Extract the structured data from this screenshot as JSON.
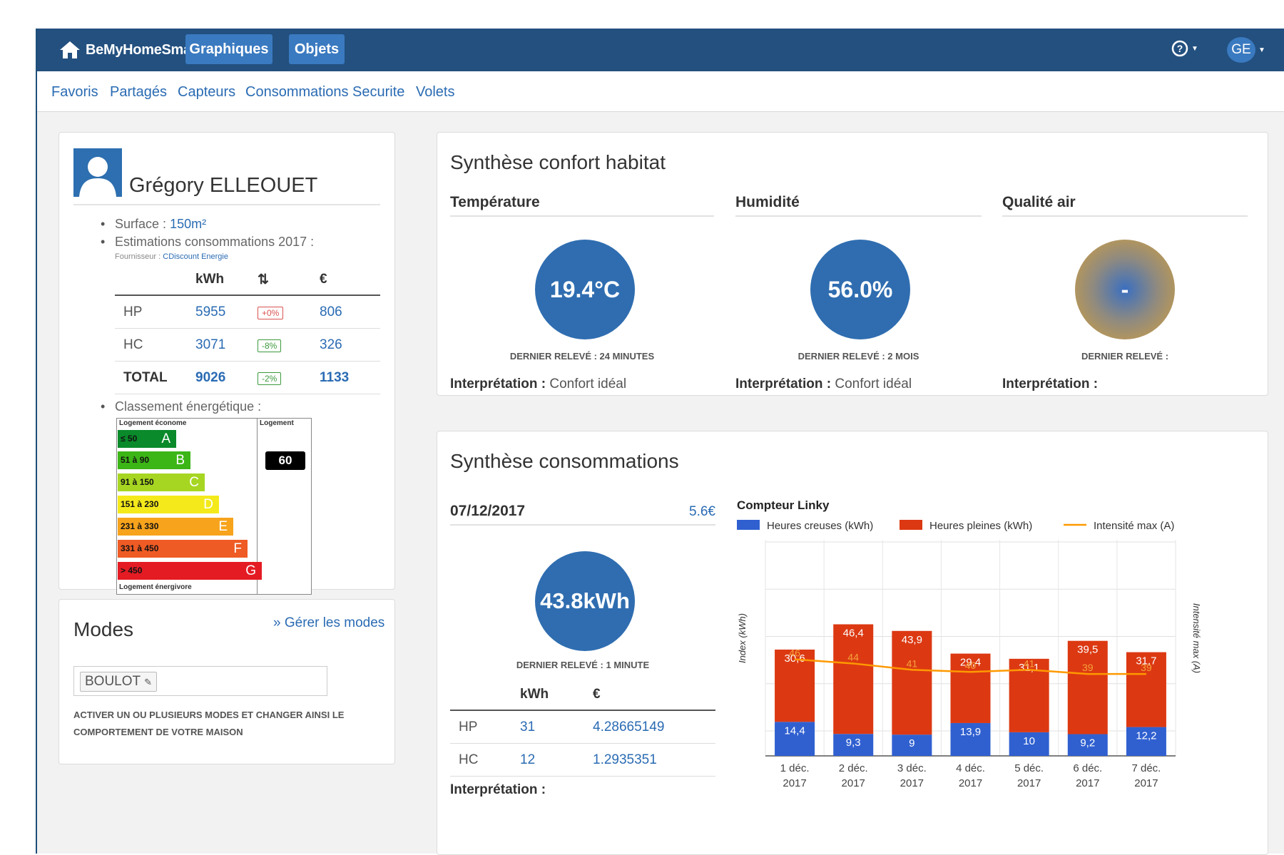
{
  "header": {
    "brand": "BeMyHomeSmart",
    "nav": [
      "Graphiques",
      "Objets"
    ],
    "help_label": "?",
    "user_initials": "GE"
  },
  "subnav": [
    "Favoris",
    "Partagés",
    "Capteurs",
    "Consommations",
    "Securite",
    "Volets"
  ],
  "profile": {
    "name": "Grégory ELLEOUET",
    "surface_label": "Surface :",
    "surface_value": "150m²",
    "estimations_label": "Estimations consommations 2017 :",
    "fournisseur_label": "Fournisseur :",
    "fournisseur_value": "CDiscount Energie",
    "table": {
      "headers": [
        "",
        "kWh",
        "⇅",
        "€"
      ],
      "rows": [
        {
          "label": "HP",
          "kwh": "5955",
          "delta": "+0%",
          "delta_color": "red",
          "eur": "806"
        },
        {
          "label": "HC",
          "kwh": "3071",
          "delta": "-8%",
          "delta_color": "green",
          "eur": "326"
        },
        {
          "label": "TOTAL",
          "kwh": "9026",
          "delta": "-2%",
          "delta_color": "green",
          "eur": "1133"
        }
      ]
    },
    "classement_label": "Classement énergétique :",
    "energy_label": {
      "top_left": "Logement économe",
      "top_right": "Logement",
      "bottom": "Logement énergivore",
      "value": "60",
      "bars": [
        {
          "range": "≤ 50",
          "letter": "A",
          "color": "#0a8a2a"
        },
        {
          "range": "51 à 90",
          "letter": "B",
          "color": "#3cb516"
        },
        {
          "range": "91 à 150",
          "letter": "C",
          "color": "#a6d622"
        },
        {
          "range": "151 à 230",
          "letter": "D",
          "color": "#f4ea1b"
        },
        {
          "range": "231 à 330",
          "letter": "E",
          "color": "#f7a31c"
        },
        {
          "range": "331 à 450",
          "letter": "F",
          "color": "#ef5b24"
        },
        {
          "range": "> 450",
          "letter": "G",
          "color": "#e41b23"
        }
      ]
    }
  },
  "modes": {
    "title": "Modes",
    "manage_link": "» Gérer les modes",
    "tag": "BOULOT",
    "help": "ACTIVER UN OU PLUSIEURS MODES ET CHANGER AINSI LE COMPORTEMENT DE VOTRE MAISON"
  },
  "confort": {
    "title": "Synthèse confort habitat",
    "interp_label": "Interprétation :",
    "items": [
      {
        "heading": "Température",
        "value": "19.4°C",
        "caption": "DERNIER RELEVÉ : 24 MINUTES",
        "interp": "Confort idéal"
      },
      {
        "heading": "Humidité",
        "value": "56.0%",
        "caption": "DERNIER RELEVÉ : 2 MOIS",
        "interp": "Confort idéal"
      },
      {
        "heading": "Qualité air",
        "value": "-",
        "caption": "DERNIER RELEVÉ :",
        "interp": ""
      }
    ]
  },
  "conso": {
    "title": "Synthèse consommations",
    "date": "07/12/2017",
    "cost": "5.6€",
    "value": "43.8kWh",
    "caption": "DERNIER RELEVÉ : 1 MINUTE",
    "table": {
      "headers": [
        "",
        "kWh",
        "€"
      ],
      "rows": [
        {
          "label": "HP",
          "kwh": "31",
          "eur": "4.28665149"
        },
        {
          "label": "HC",
          "kwh": "12",
          "eur": "1.2935351"
        }
      ]
    },
    "interp_label": "Interprétation :"
  },
  "chart_data": {
    "type": "bar",
    "title": "Compteur Linky",
    "ylabel": "Index (kWh)",
    "y2label": "Intensité max (A)",
    "categories": [
      [
        "1 déc.",
        "2017"
      ],
      [
        "2 déc.",
        "2017"
      ],
      [
        "3 déc.",
        "2017"
      ],
      [
        "4 déc.",
        "2017"
      ],
      [
        "5 déc.",
        "2017"
      ],
      [
        "6 déc.",
        "2017"
      ],
      [
        "7 déc.",
        "2017"
      ]
    ],
    "stacked": true,
    "series": [
      {
        "name": "Heures creuses (kWh)",
        "color": "#3060d0",
        "values": [
          14.4,
          9.3,
          9,
          13.9,
          10,
          9.2,
          12.2
        ],
        "labels": [
          "14,4",
          "9,3",
          "9",
          "13,9",
          "10",
          "9,2",
          "12,2"
        ]
      },
      {
        "name": "Heures pleines (kWh)",
        "color": "#dc3912",
        "values": [
          30.6,
          46.4,
          43.9,
          29.4,
          31.1,
          39.5,
          31.7
        ],
        "labels": [
          "30,6",
          "46,4",
          "43,9",
          "29,4",
          "31,1",
          "39,5",
          "31,7"
        ]
      }
    ],
    "line": {
      "name": "Intensité max (A)",
      "color": "#ff9900",
      "values": [
        46,
        44,
        41,
        40,
        41,
        39,
        39
      ],
      "labels": [
        "46",
        "44",
        "41",
        "40",
        "41",
        "39",
        "39"
      ]
    },
    "grid": true,
    "legend": "top"
  }
}
